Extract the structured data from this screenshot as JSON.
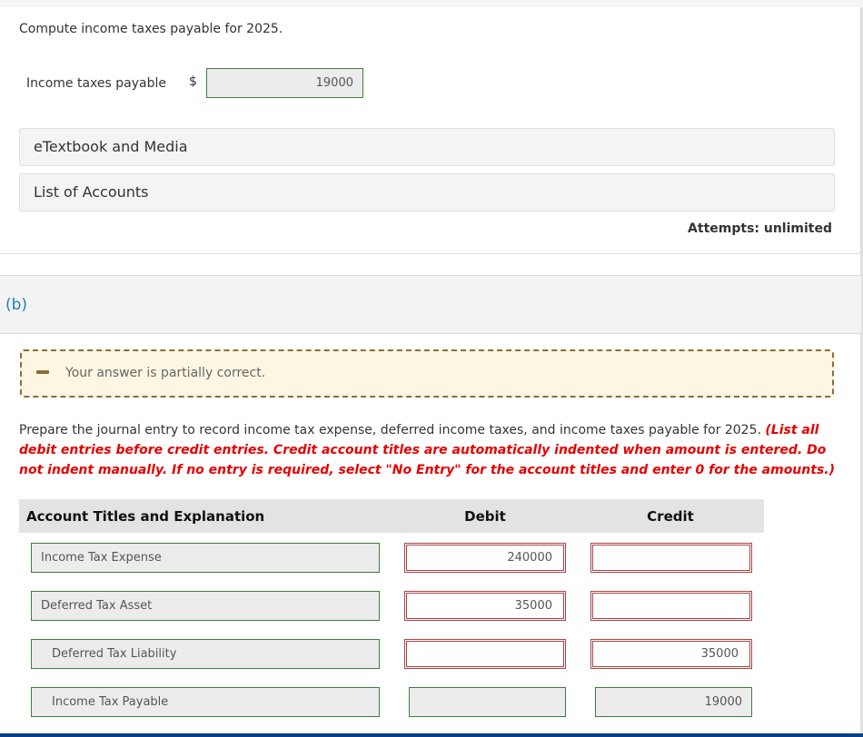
{
  "part_a": {
    "question": "Compute income taxes payable for 2025.",
    "field_label": "Income taxes payable",
    "currency_symbol": "$",
    "field_value": "19000",
    "resources": [
      {
        "label": "eTextbook and Media"
      },
      {
        "label": "List of Accounts"
      }
    ],
    "attempts": "Attempts: unlimited"
  },
  "part_b": {
    "label": "(b)",
    "notice": {
      "icon": "minus-icon",
      "text": "Your answer is partially correct.",
      "border_color": "#8b6d3a",
      "background": "#fdf6e3"
    },
    "instructions": {
      "main": "Prepare the journal entry to record income tax expense, deferred income taxes, and income taxes payable for 2025. ",
      "note": "(List all debit entries before credit entries. Credit account titles are automatically indented when amount is entered. Do not indent manually. If no entry is required, select \"No Entry\" for the account titles and enter 0 for the amounts.)"
    },
    "table": {
      "headers": {
        "account": "Account Titles and Explanation",
        "debit": "Debit",
        "credit": "Credit"
      },
      "rows": [
        {
          "account": "Income Tax Expense",
          "debit": "240000",
          "credit": "",
          "account_status": "correct",
          "debit_status": "incorrect",
          "credit_status": "incorrect"
        },
        {
          "account": "Deferred Tax Asset",
          "debit": "35000",
          "credit": "",
          "account_status": "correct",
          "debit_status": "incorrect",
          "credit_status": "incorrect"
        },
        {
          "account": "Deferred Tax Liability",
          "debit": "",
          "credit": "35000",
          "account_status": "correct",
          "debit_status": "incorrect",
          "credit_status": "incorrect"
        },
        {
          "account": "Income Tax Payable",
          "debit": "",
          "credit": "19000",
          "account_status": "correct",
          "debit_status": "correct",
          "credit_status": "correct"
        }
      ]
    }
  },
  "colors": {
    "correct_border": "#3e7d3e",
    "incorrect_border": "#a94442",
    "part_label": "#1f7fb8",
    "instruction_note": "#e60000",
    "footer_bar": "#0a3f86"
  }
}
